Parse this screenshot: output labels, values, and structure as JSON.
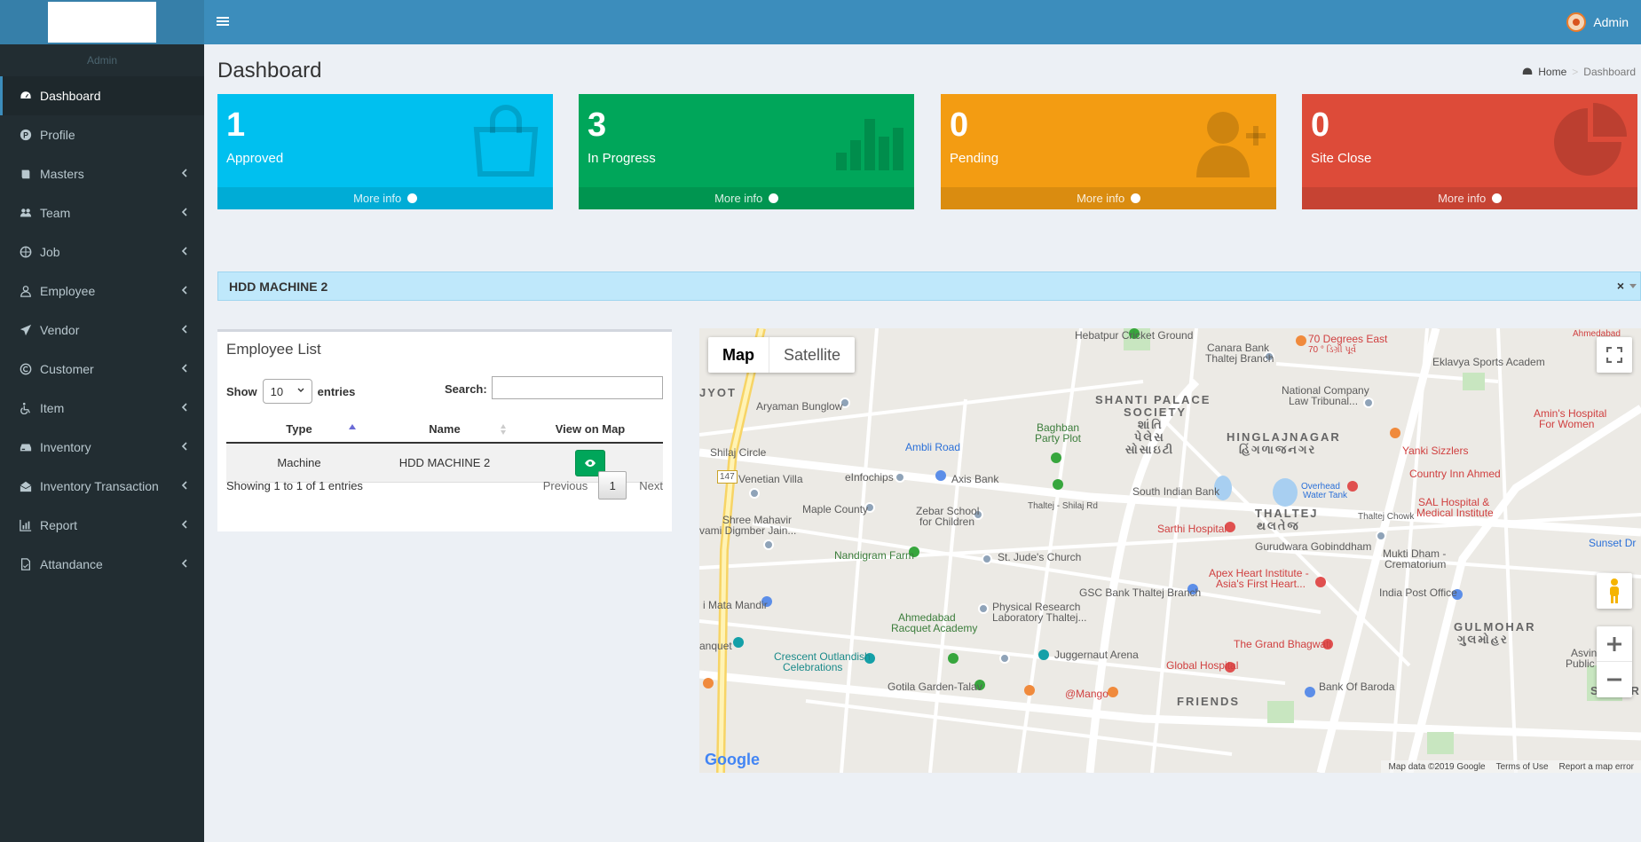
{
  "sidebar": {
    "user_name": "Admin",
    "items": [
      {
        "label": "Dashboard",
        "icon": "dashboard-icon"
      },
      {
        "label": "Profile",
        "icon": "profile-icon"
      },
      {
        "label": "Masters",
        "icon": "book-icon"
      },
      {
        "label": "Team",
        "icon": "users-icon"
      },
      {
        "label": "Job",
        "icon": "globe-icon"
      },
      {
        "label": "Employee",
        "icon": "user-icon"
      },
      {
        "label": "Vendor",
        "icon": "paper-plane-icon"
      },
      {
        "label": "Customer",
        "icon": "copyright-icon"
      },
      {
        "label": "Item",
        "icon": "wheelchair-icon"
      },
      {
        "label": "Inventory",
        "icon": "hdd-icon"
      },
      {
        "label": "Inventory Transaction",
        "icon": "envelope-open-icon"
      },
      {
        "label": "Report",
        "icon": "bar-chart-icon"
      },
      {
        "label": "Attandance",
        "icon": "file-icon"
      }
    ]
  },
  "header": {
    "user": "Admin"
  },
  "page": {
    "title": "Dashboard",
    "breadcrumb": {
      "home": "Home",
      "current": "Dashboard"
    }
  },
  "stats": [
    {
      "value": "1",
      "label": "Approved",
      "more": "More info",
      "color": "#00c0ef"
    },
    {
      "value": "3",
      "label": "In Progress",
      "more": "More info",
      "color": "#00a65a"
    },
    {
      "value": "0",
      "label": "Pending",
      "more": "More info",
      "color": "#f39c12"
    },
    {
      "value": "0",
      "label": "Site Close",
      "more": "More info",
      "color": "#dd4b39"
    }
  ],
  "machine_bar": {
    "title": "HDD MACHINE 2",
    "close": "×"
  },
  "employee_list": {
    "title": "Employee List",
    "show": "Show",
    "entries_value": "10",
    "entries": "entries",
    "search_label": "Search:",
    "columns": [
      "Type",
      "Name",
      "View on Map"
    ],
    "rows": [
      {
        "type": "Machine",
        "name": "HDD MACHINE 2"
      }
    ],
    "info": "Showing 1 to 1 of 1 entries",
    "prev": "Previous",
    "page": "1",
    "next": "Next"
  },
  "map": {
    "type_map": "Map",
    "type_satellite": "Satellite",
    "logo": "Google",
    "attribution": [
      "Map data ©2019 Google",
      "Terms of Use",
      "Report a map error"
    ],
    "labels": {
      "l1": "Hebatpur Cricket Ground",
      "l2": "70 Degrees East",
      "l3": "70 ° ડિગ્રી પૂર્વ",
      "l4": "Canara Bank",
      "l5": "Thaltej Branch",
      "l6": "Eklavya Sports Academ",
      "l7": "Aryaman Bunglow",
      "l8": "SHANTI PALACE",
      "l9": "SOCIETY",
      "l10": "શાંતિ",
      "l11": "પેલેસ",
      "l12": "સોસાઇટી",
      "l13": "National Company",
      "l14": "Law Tribunal...",
      "l15": "Amin's Hospital",
      "l16": "For Women",
      "l17": "Shilaj Circle",
      "l18": "Ambli Road",
      "l19": "Baghban",
      "l20": "Party Plot",
      "l21": "HINGLAJNAGAR",
      "l22": "હિંગળાજનગર",
      "l23": "Yanki Sizzlers",
      "l24": "Venetian Villa",
      "l25": "eInfochips",
      "l26": "Axis Bank",
      "l27": "Overhead",
      "l28": "Water Tank",
      "l29": "Country Inn Ahmed",
      "l30": "South Indian Bank",
      "l31": "Maple County",
      "l32": "Zebar School",
      "l33": "for Children",
      "l34": "Thaltej - Shilaj Rd",
      "l35": "THALTEJ",
      "l36": "થલતેજ",
      "l37": "Thaltej Chowk",
      "l38": "SAL Hospital &",
      "l39": "Medical Institute",
      "l40": "Shree Mahavir",
      "l41": "vami Digmber Jain...",
      "l42": "Sarthi Hospital",
      "l43": "Gurudwara Gobinddham",
      "l44": "Sunset Dr",
      "l45": "Nandigram Farm",
      "l46": "St. Jude's Church",
      "l47": "Mukti Dham -",
      "l48": "Crematorium",
      "l49": "Apex Heart Institute -",
      "l50": "Asia's First Heart...",
      "l51": "GSC Bank Thaltej Branch",
      "l52": "India Post Office",
      "l53": "i Mata Mandir",
      "l54": "Ahmedabad",
      "l55": "Racquet Academy",
      "l56": "Physical Research",
      "l57": "Laboratory Thaltej...",
      "l58": "GULMOHAR",
      "l59": "ગુલમોહર",
      "l60": "anquet",
      "l61": "The Grand Bhagwati",
      "l62": "Crescent Outlandish",
      "l63": "Celebrations",
      "l64": "Juggernaut Arena",
      "l65": "Asvini",
      "l66": "Public Park",
      "l67": "Global Hospital",
      "l68": "Gotila Garden-Talav",
      "l69": "@Mango",
      "l70": "Bank Of Baroda",
      "l71": "FRIENDS",
      "l72": "SUMER",
      "l73": "JYOT",
      "l74": "147",
      "l75": "Ahmedabad"
    }
  }
}
